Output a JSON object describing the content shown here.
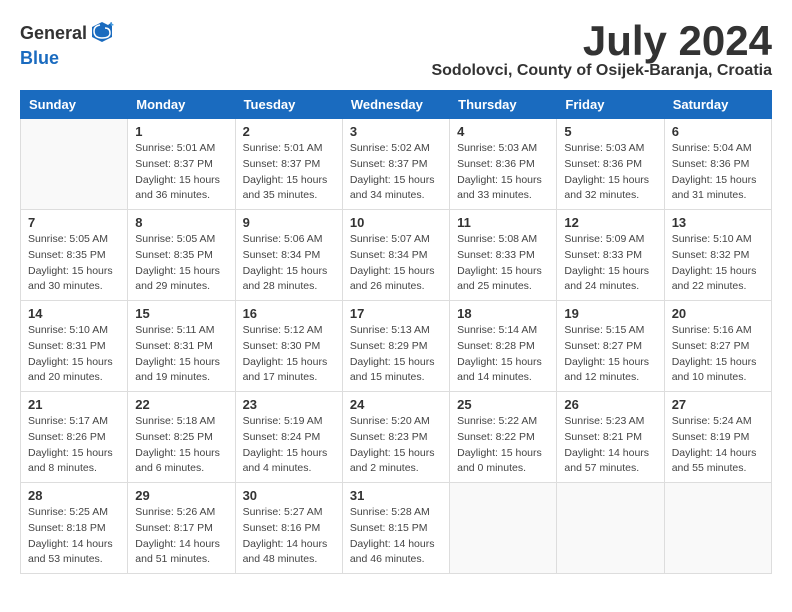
{
  "logo": {
    "general": "General",
    "blue": "Blue"
  },
  "title": "July 2024",
  "location": "Sodolovci, County of Osijek-Baranja, Croatia",
  "days_of_week": [
    "Sunday",
    "Monday",
    "Tuesday",
    "Wednesday",
    "Thursday",
    "Friday",
    "Saturday"
  ],
  "weeks": [
    [
      {
        "day": null,
        "sunrise": null,
        "sunset": null,
        "daylight": null
      },
      {
        "day": "1",
        "sunrise": "Sunrise: 5:01 AM",
        "sunset": "Sunset: 8:37 PM",
        "daylight": "Daylight: 15 hours and 36 minutes."
      },
      {
        "day": "2",
        "sunrise": "Sunrise: 5:01 AM",
        "sunset": "Sunset: 8:37 PM",
        "daylight": "Daylight: 15 hours and 35 minutes."
      },
      {
        "day": "3",
        "sunrise": "Sunrise: 5:02 AM",
        "sunset": "Sunset: 8:37 PM",
        "daylight": "Daylight: 15 hours and 34 minutes."
      },
      {
        "day": "4",
        "sunrise": "Sunrise: 5:03 AM",
        "sunset": "Sunset: 8:36 PM",
        "daylight": "Daylight: 15 hours and 33 minutes."
      },
      {
        "day": "5",
        "sunrise": "Sunrise: 5:03 AM",
        "sunset": "Sunset: 8:36 PM",
        "daylight": "Daylight: 15 hours and 32 minutes."
      },
      {
        "day": "6",
        "sunrise": "Sunrise: 5:04 AM",
        "sunset": "Sunset: 8:36 PM",
        "daylight": "Daylight: 15 hours and 31 minutes."
      }
    ],
    [
      {
        "day": "7",
        "sunrise": "Sunrise: 5:05 AM",
        "sunset": "Sunset: 8:35 PM",
        "daylight": "Daylight: 15 hours and 30 minutes."
      },
      {
        "day": "8",
        "sunrise": "Sunrise: 5:05 AM",
        "sunset": "Sunset: 8:35 PM",
        "daylight": "Daylight: 15 hours and 29 minutes."
      },
      {
        "day": "9",
        "sunrise": "Sunrise: 5:06 AM",
        "sunset": "Sunset: 8:34 PM",
        "daylight": "Daylight: 15 hours and 28 minutes."
      },
      {
        "day": "10",
        "sunrise": "Sunrise: 5:07 AM",
        "sunset": "Sunset: 8:34 PM",
        "daylight": "Daylight: 15 hours and 26 minutes."
      },
      {
        "day": "11",
        "sunrise": "Sunrise: 5:08 AM",
        "sunset": "Sunset: 8:33 PM",
        "daylight": "Daylight: 15 hours and 25 minutes."
      },
      {
        "day": "12",
        "sunrise": "Sunrise: 5:09 AM",
        "sunset": "Sunset: 8:33 PM",
        "daylight": "Daylight: 15 hours and 24 minutes."
      },
      {
        "day": "13",
        "sunrise": "Sunrise: 5:10 AM",
        "sunset": "Sunset: 8:32 PM",
        "daylight": "Daylight: 15 hours and 22 minutes."
      }
    ],
    [
      {
        "day": "14",
        "sunrise": "Sunrise: 5:10 AM",
        "sunset": "Sunset: 8:31 PM",
        "daylight": "Daylight: 15 hours and 20 minutes."
      },
      {
        "day": "15",
        "sunrise": "Sunrise: 5:11 AM",
        "sunset": "Sunset: 8:31 PM",
        "daylight": "Daylight: 15 hours and 19 minutes."
      },
      {
        "day": "16",
        "sunrise": "Sunrise: 5:12 AM",
        "sunset": "Sunset: 8:30 PM",
        "daylight": "Daylight: 15 hours and 17 minutes."
      },
      {
        "day": "17",
        "sunrise": "Sunrise: 5:13 AM",
        "sunset": "Sunset: 8:29 PM",
        "daylight": "Daylight: 15 hours and 15 minutes."
      },
      {
        "day": "18",
        "sunrise": "Sunrise: 5:14 AM",
        "sunset": "Sunset: 8:28 PM",
        "daylight": "Daylight: 15 hours and 14 minutes."
      },
      {
        "day": "19",
        "sunrise": "Sunrise: 5:15 AM",
        "sunset": "Sunset: 8:27 PM",
        "daylight": "Daylight: 15 hours and 12 minutes."
      },
      {
        "day": "20",
        "sunrise": "Sunrise: 5:16 AM",
        "sunset": "Sunset: 8:27 PM",
        "daylight": "Daylight: 15 hours and 10 minutes."
      }
    ],
    [
      {
        "day": "21",
        "sunrise": "Sunrise: 5:17 AM",
        "sunset": "Sunset: 8:26 PM",
        "daylight": "Daylight: 15 hours and 8 minutes."
      },
      {
        "day": "22",
        "sunrise": "Sunrise: 5:18 AM",
        "sunset": "Sunset: 8:25 PM",
        "daylight": "Daylight: 15 hours and 6 minutes."
      },
      {
        "day": "23",
        "sunrise": "Sunrise: 5:19 AM",
        "sunset": "Sunset: 8:24 PM",
        "daylight": "Daylight: 15 hours and 4 minutes."
      },
      {
        "day": "24",
        "sunrise": "Sunrise: 5:20 AM",
        "sunset": "Sunset: 8:23 PM",
        "daylight": "Daylight: 15 hours and 2 minutes."
      },
      {
        "day": "25",
        "sunrise": "Sunrise: 5:22 AM",
        "sunset": "Sunset: 8:22 PM",
        "daylight": "Daylight: 15 hours and 0 minutes."
      },
      {
        "day": "26",
        "sunrise": "Sunrise: 5:23 AM",
        "sunset": "Sunset: 8:21 PM",
        "daylight": "Daylight: 14 hours and 57 minutes."
      },
      {
        "day": "27",
        "sunrise": "Sunrise: 5:24 AM",
        "sunset": "Sunset: 8:19 PM",
        "daylight": "Daylight: 14 hours and 55 minutes."
      }
    ],
    [
      {
        "day": "28",
        "sunrise": "Sunrise: 5:25 AM",
        "sunset": "Sunset: 8:18 PM",
        "daylight": "Daylight: 14 hours and 53 minutes."
      },
      {
        "day": "29",
        "sunrise": "Sunrise: 5:26 AM",
        "sunset": "Sunset: 8:17 PM",
        "daylight": "Daylight: 14 hours and 51 minutes."
      },
      {
        "day": "30",
        "sunrise": "Sunrise: 5:27 AM",
        "sunset": "Sunset: 8:16 PM",
        "daylight": "Daylight: 14 hours and 48 minutes."
      },
      {
        "day": "31",
        "sunrise": "Sunrise: 5:28 AM",
        "sunset": "Sunset: 8:15 PM",
        "daylight": "Daylight: 14 hours and 46 minutes."
      },
      {
        "day": null,
        "sunrise": null,
        "sunset": null,
        "daylight": null
      },
      {
        "day": null,
        "sunrise": null,
        "sunset": null,
        "daylight": null
      },
      {
        "day": null,
        "sunrise": null,
        "sunset": null,
        "daylight": null
      }
    ]
  ]
}
